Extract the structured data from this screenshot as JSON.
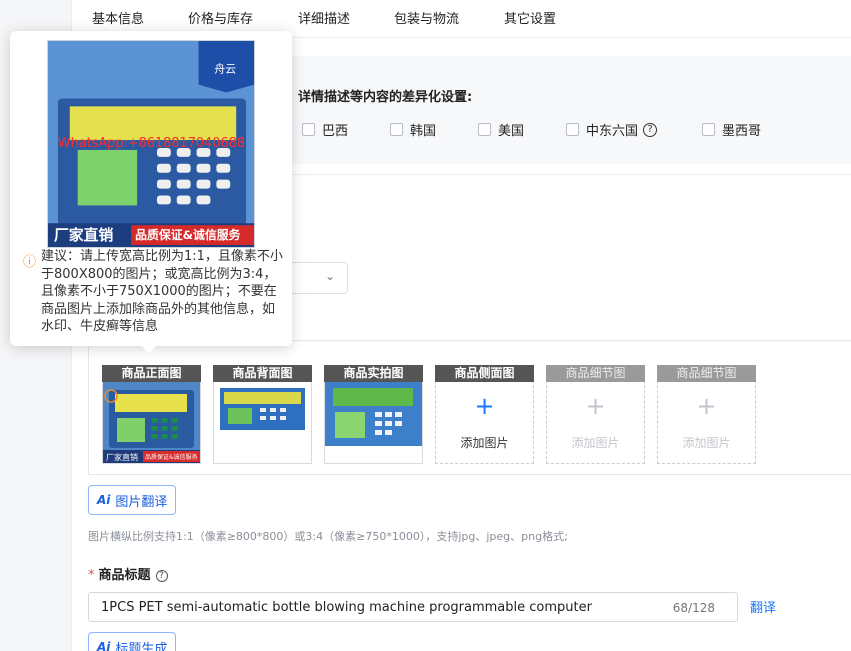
{
  "tabs": [
    "基本信息",
    "价格与库存",
    "详细描述",
    "包装与物流",
    "其它设置"
  ],
  "diff_settings": {
    "title": "详情描述等内容的差异化设置:",
    "countries": [
      "巴西",
      "韩国",
      "美国",
      "中东六国",
      "墨西哥"
    ],
    "help_icon": "question-circle-icon"
  },
  "tooltip": {
    "image_watermark": "WhatsApp:+8618817040688",
    "image_banner_left": "厂家直销",
    "image_banner_right": "品质保证&诚信服务",
    "image_logo_text": "舟云",
    "suggestion": "建议：请上传宽高比例为1:1，且像素不小于800X800的图片；或宽高比例为3:4，且像素不小于750X1000的图片；不要在商品图片上添加除商品外的其他信息，如水印、牛皮癣等信息",
    "warn_icon": "warning-circle-icon"
  },
  "image_slots": [
    {
      "label": "商品正面图",
      "state": "filled"
    },
    {
      "label": "商品背面图",
      "state": "filled"
    },
    {
      "label": "商品实拍图",
      "state": "filled"
    },
    {
      "label": "商品侧面图",
      "state": "add",
      "add_text": "添加图片"
    },
    {
      "label": "商品细节图",
      "state": "disabled",
      "add_text": "添加图片"
    },
    {
      "label": "商品细节图",
      "state": "disabled",
      "add_text": "添加图片"
    }
  ],
  "thumb_texts": {
    "banner_left": "厂家直销",
    "banner_right": "品质保证&诚信服务"
  },
  "image_translate_button": {
    "badge": "Ai",
    "label": "图片翻译"
  },
  "image_hint": "图片横纵比例支持1:1（像素≥800*800）或3:4（像素≥750*1000），支持jpg、jpeg、png格式;",
  "product_title": {
    "required_mark": "*",
    "label": "商品标题",
    "value": "1PCS PET semi-automatic bottle blowing machine programmable computer",
    "count": "68/128",
    "translate_link": "翻译"
  },
  "title_generate_button": {
    "badge": "Ai",
    "label": "标题生成"
  },
  "colors": {
    "accent": "#1677ff",
    "required": "#e34d59",
    "warning": "#f08a24"
  }
}
